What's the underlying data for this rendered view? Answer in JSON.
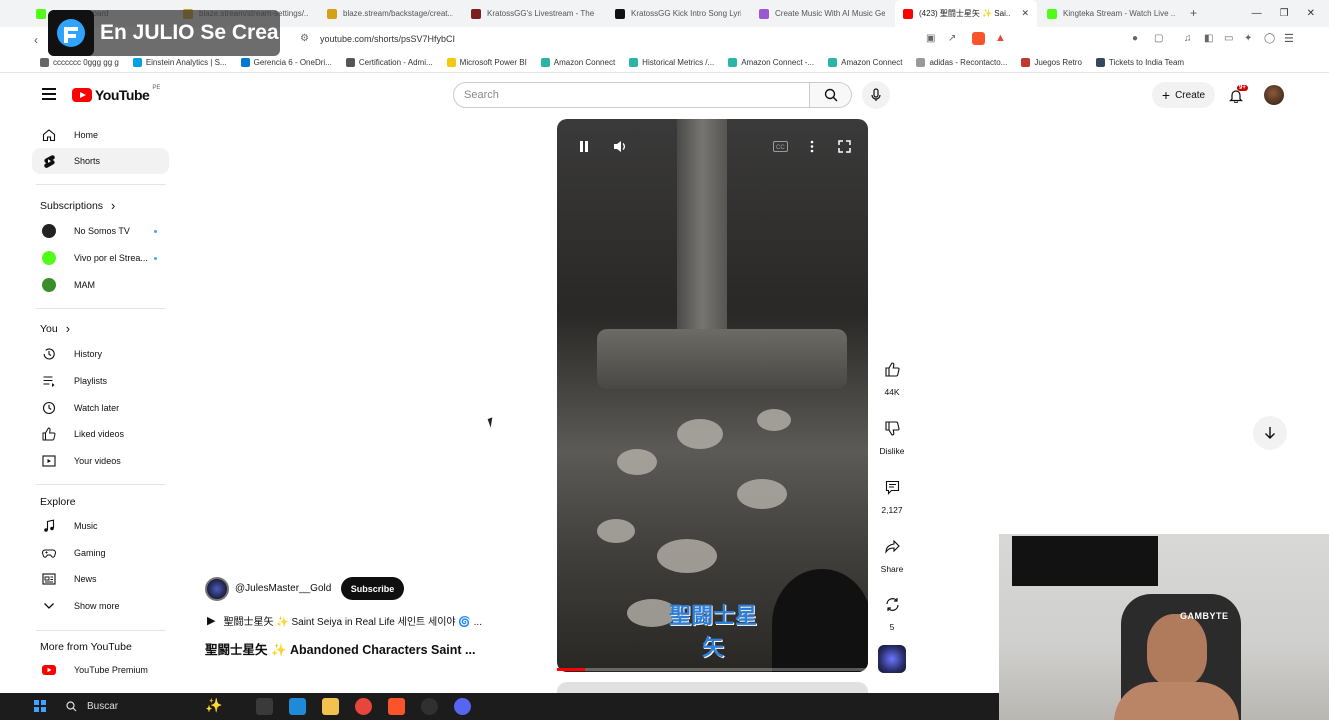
{
  "browser": {
    "tabs": [
      {
        "label": "Kick Dashboard",
        "color": "#53fc18"
      },
      {
        "label": "blaze.stream/stream-settings/...",
        "color": "#d4a017"
      },
      {
        "label": "blaze.stream/backstage/creat...",
        "color": "#d4a017"
      },
      {
        "label": "KratossGG's Livestream - The ...",
        "color": "#7a1f1f"
      },
      {
        "label": "KratossGG Kick Intro Song Lyri...",
        "color": "#111111"
      },
      {
        "label": "Create Music With AI Music Ge...",
        "color": "#9b59d0"
      },
      {
        "label": "(423) 聖闘士星矢 ✨ Sai...",
        "color": "#ff0000",
        "active": true
      },
      {
        "label": "Kingteka Stream - Watch Live ...",
        "color": "#53fc18"
      }
    ],
    "new_tab": "+",
    "url": "youtube.com/shorts/psSV7HfybCI",
    "bookmarks": [
      {
        "label": "ccccccc 0ggg gg g",
        "color": "#666666"
      },
      {
        "label": "Einstein Analytics | S...",
        "color": "#00a1e0"
      },
      {
        "label": "Gerencia 6 - OneDri...",
        "color": "#0078d4"
      },
      {
        "label": "Certification - Admi...",
        "color": "#555555"
      },
      {
        "label": "Microsoft Power BI",
        "color": "#f2c811"
      },
      {
        "label": "Amazon Connect",
        "color": "#2bb5a6"
      },
      {
        "label": "Historical Metrics /...",
        "color": "#2bb5a6"
      },
      {
        "label": "Amazon Connect -...",
        "color": "#2bb5a6"
      },
      {
        "label": "Amazon Connect",
        "color": "#2bb5a6"
      },
      {
        "label": "adidas - Recontacto...",
        "color": "#999999"
      },
      {
        "label": "Juegos Retro",
        "color": "#c0392b"
      },
      {
        "label": "Tickets to India Team",
        "color": "#34495e"
      }
    ],
    "stream_overlay_text": "En JULIO Se Crea"
  },
  "youtube": {
    "logo_text": "YouTube",
    "country_code": "PE",
    "search_placeholder": "Search",
    "create_label": "Create",
    "notifications_badge": "9+",
    "sidebar": {
      "main": [
        {
          "label": "Home",
          "icon": "home-icon"
        },
        {
          "label": "Shorts",
          "icon": "shorts-icon",
          "active": true
        }
      ],
      "subscriptions_title": "Subscriptions",
      "subscriptions": [
        {
          "label": "No Somos TV",
          "color": "#222222"
        },
        {
          "label": "Vivo por el Strea...",
          "color": "#53fc18"
        },
        {
          "label": "MAM",
          "color": "#3b8c2a"
        }
      ],
      "you_title": "You",
      "you": [
        {
          "label": "History",
          "icon": "history-icon"
        },
        {
          "label": "Playlists",
          "icon": "playlists-icon"
        },
        {
          "label": "Watch later",
          "icon": "watch-later-icon"
        },
        {
          "label": "Liked videos",
          "icon": "liked-icon"
        },
        {
          "label": "Your videos",
          "icon": "your-videos-icon"
        }
      ],
      "explore_title": "Explore",
      "explore": [
        {
          "label": "Music",
          "icon": "music-icon"
        },
        {
          "label": "Gaming",
          "icon": "gaming-icon"
        },
        {
          "label": "News",
          "icon": "news-icon"
        },
        {
          "label": "Show more",
          "icon": "chevron-down-icon"
        }
      ],
      "more_title": "More from YouTube",
      "more": [
        {
          "label": "YouTube Premium",
          "icon": "youtube-premium-icon"
        }
      ]
    },
    "short": {
      "channel": "@JulesMaster__Gold",
      "subscribe_label": "Subscribe",
      "sound": "聖闘士星矢 ✨ Saint Seiya in Real Life 세인트 세이야 🌀 ...",
      "title": "聖闘士星矢 ✨ Abandoned Characters Saint ...",
      "watermark": "聖闘士星矢",
      "progress_fraction": 0.09
    },
    "actions": {
      "likes": "44K",
      "dislike_label": "Dislike",
      "comments": "2,127",
      "share_label": "Share",
      "remix_count": "5"
    }
  },
  "webcam": {
    "shirt_text": "GAMBYTE"
  },
  "taskbar": {
    "search_label": "Buscar",
    "apps": [
      {
        "name": "task-view-icon",
        "color": "#3a3a3a"
      },
      {
        "name": "edge-icon",
        "color": "#1f8ad8"
      },
      {
        "name": "file-explorer-icon",
        "color": "#f2c14e"
      },
      {
        "name": "chrome-icon",
        "color": "#e8453c"
      },
      {
        "name": "brave-icon",
        "color": "#fb542b"
      },
      {
        "name": "obs-icon",
        "color": "#303030"
      },
      {
        "name": "app-icon",
        "color": "#5865f2"
      }
    ]
  }
}
